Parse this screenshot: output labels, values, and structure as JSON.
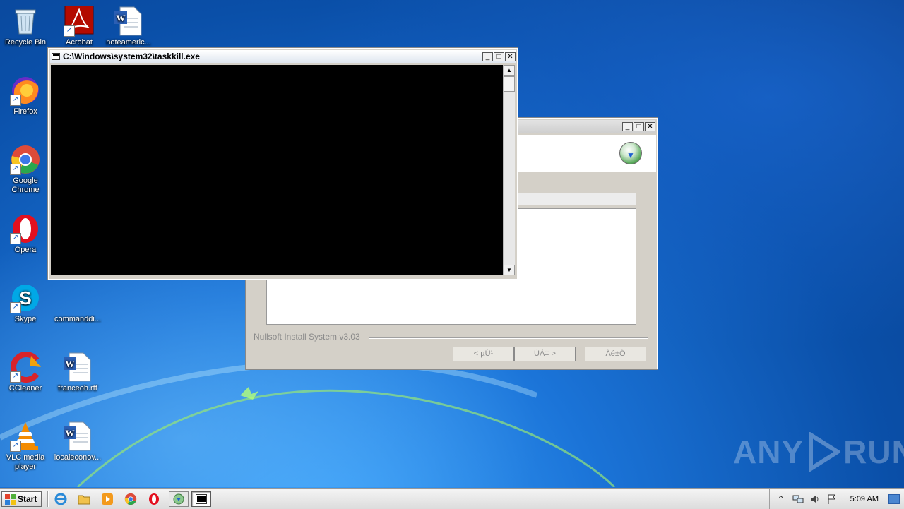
{
  "desktop": {
    "icons": [
      {
        "label": "Recycle Bin",
        "icon": "recycle-bin-icon"
      },
      {
        "label": "Acrobat",
        "icon": "acrobat-icon"
      },
      {
        "label": "noteameric...",
        "icon": "word-document-icon"
      },
      {
        "label": "Firefox",
        "icon": "firefox-icon"
      },
      {
        "label": "Google Chrome",
        "icon": "chrome-icon"
      },
      {
        "label": "Opera",
        "icon": "opera-icon"
      },
      {
        "label": "Skype",
        "icon": "skype-icon"
      },
      {
        "label": "commanddi...",
        "icon": "blank-file-icon"
      },
      {
        "label": "CCleaner",
        "icon": "ccleaner-icon"
      },
      {
        "label": "franceoh.rtf",
        "icon": "word-document-icon"
      },
      {
        "label": "VLC media player",
        "icon": "vlc-icon"
      },
      {
        "label": "localeconov...",
        "icon": "word-document-icon"
      }
    ]
  },
  "console": {
    "title": "C:\\Windows\\system32\\taskkill.exe"
  },
  "installer": {
    "title": "",
    "brand": "Nullsoft Install System v3.03",
    "buttons": {
      "back": "< µÚ¹",
      "next": "ÙÀ‡ >",
      "cancel": "Äé±Ó"
    }
  },
  "taskbar": {
    "start_label": "Start",
    "clock": "5:09 AM"
  },
  "watermark": {
    "left": "ANY",
    "right": "RUN"
  },
  "colors": {
    "desktop_blue": "#1b74d8",
    "console_bg": "#000000",
    "window_face": "#d4d0c8"
  }
}
